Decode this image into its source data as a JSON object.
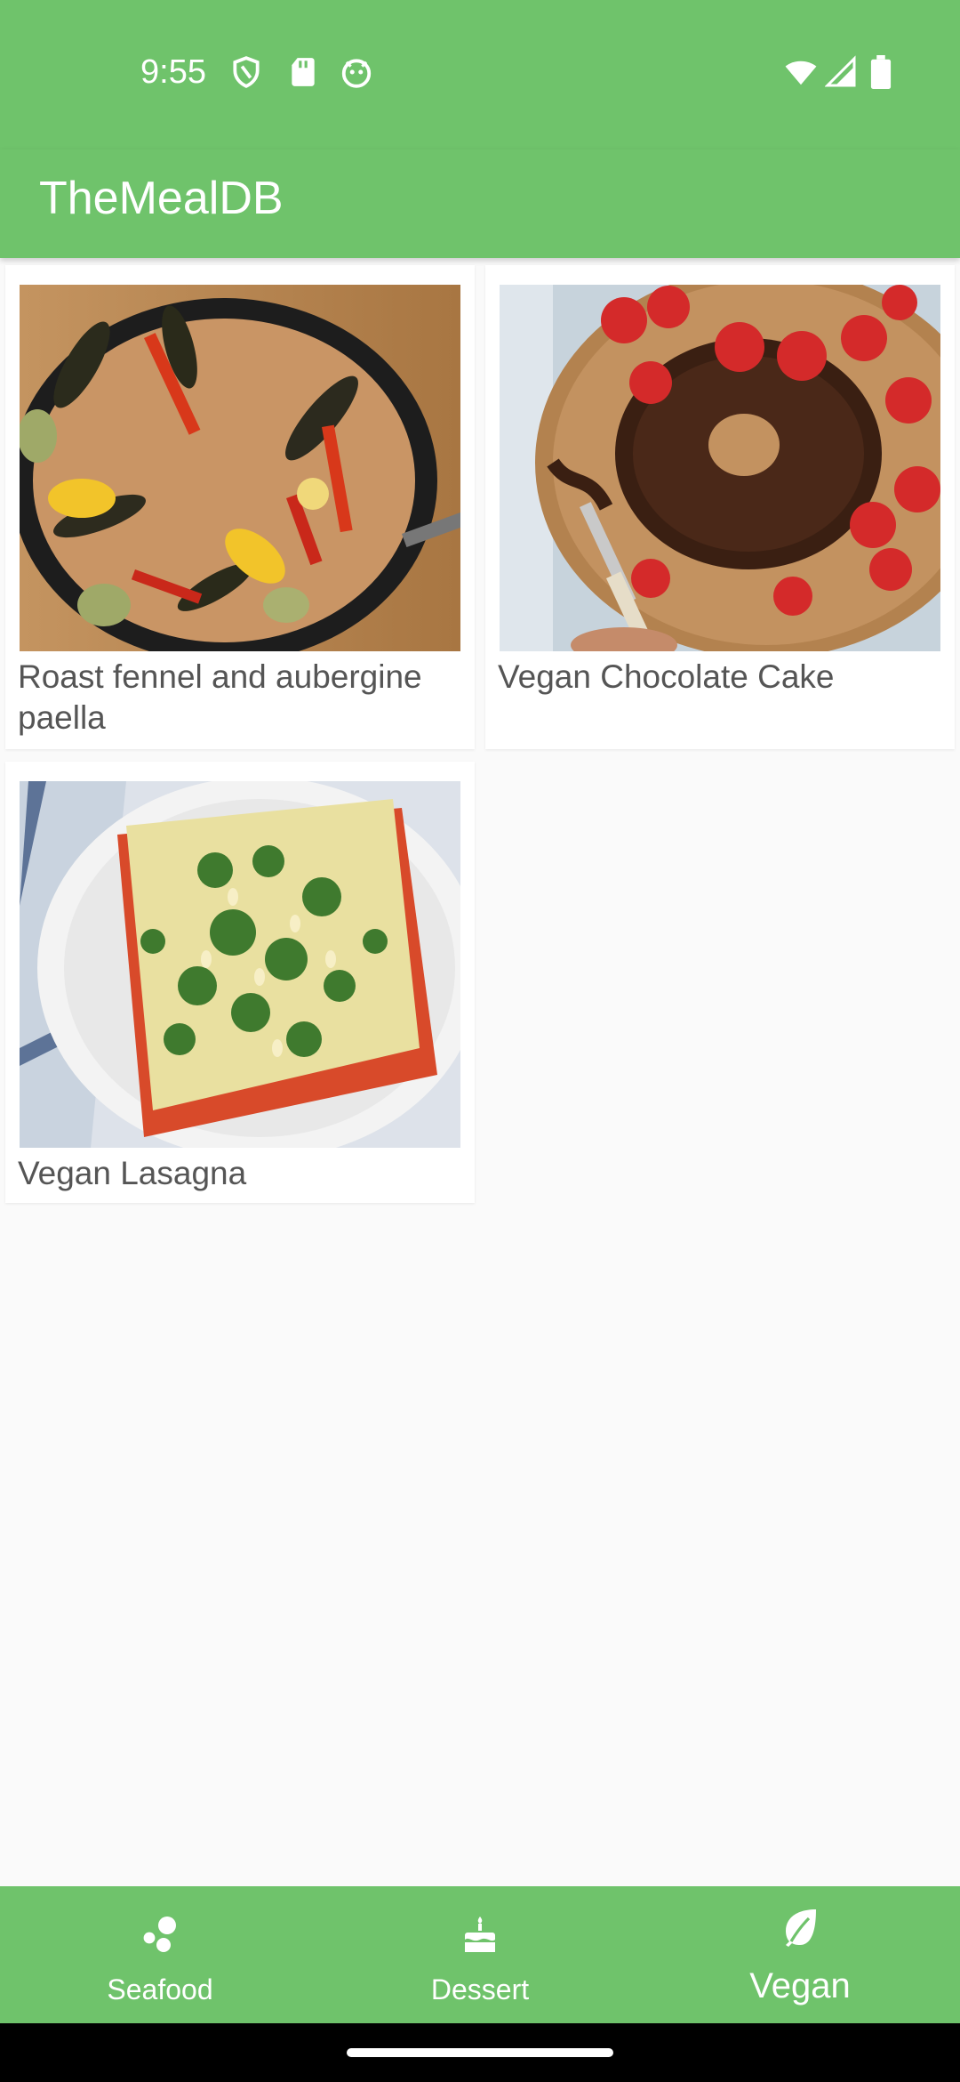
{
  "status_bar": {
    "time": "9:55",
    "icons": [
      "shield-icon",
      "sd-card-icon",
      "android-icon",
      "wifi-icon",
      "signal-icon",
      "battery-icon"
    ]
  },
  "app_bar": {
    "title": "TheMealDB"
  },
  "meals": [
    {
      "title": "Roast fennel and aubergine paella",
      "image": "paella-photo"
    },
    {
      "title": "Vegan Chocolate Cake",
      "image": "chocolate-cake-photo"
    },
    {
      "title": "Vegan Lasagna",
      "image": "lasagna-photo"
    }
  ],
  "bottom_nav": {
    "items": [
      {
        "label": "Seafood",
        "icon": "seafood-icon",
        "active": false
      },
      {
        "label": "Dessert",
        "icon": "cake-icon",
        "active": false
      },
      {
        "label": "Vegan",
        "icon": "leaf-icon",
        "active": true
      }
    ]
  },
  "colors": {
    "primary": "#6fc36b",
    "background": "#fafafa",
    "text": "#555555"
  }
}
